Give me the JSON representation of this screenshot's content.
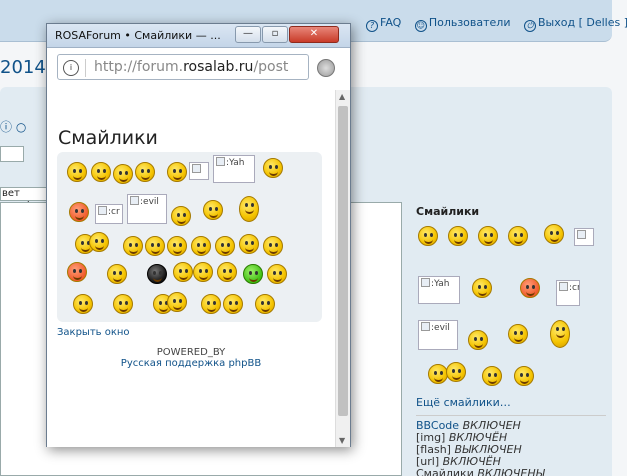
{
  "topnav": {
    "faq": "FAQ",
    "members": "Пользователи",
    "logout": "Выход [ Delles ]"
  },
  "page": {
    "date_fragment": "2014.",
    "font_color_label": "вет шриф"
  },
  "sidebar": {
    "title": "Смайлики",
    "broken": {
      "yahoo": ":Yah",
      "cr": ":cr",
      "evil": ":evil"
    },
    "more_link": "Ещё смайлики…",
    "status": [
      {
        "label": "BBCode",
        "value": "ВКЛЮЧЕН"
      },
      {
        "label": "[img]",
        "value": "ВКЛЮЧЁН"
      },
      {
        "label": "[flash]",
        "value": "ВЫКЛЮЧЕН"
      },
      {
        "label": "[url]",
        "value": "ВКЛЮЧЁН"
      },
      {
        "label": "Смайлики",
        "value": "ВКЛЮЧЕНЫ"
      }
    ]
  },
  "popup": {
    "window_title": "ROSAForum • Смайлики — ...",
    "url_prefix": "http://forum.",
    "url_domain": "rosalab.ru",
    "url_suffix": "/post",
    "heading": "Смайлики",
    "broken": {
      "yahoo": ":Yah",
      "cr": ":cr",
      "evil": ":evil"
    },
    "close_link": "Закрыть окно",
    "powered_by": "POWERED_BY",
    "phpbb_link": "Русская поддержка phpBB"
  },
  "icons": {
    "faq": "question-icon",
    "members": "users-icon",
    "logout": "power-icon",
    "lock": "info-icon",
    "globe": "globe-icon"
  }
}
